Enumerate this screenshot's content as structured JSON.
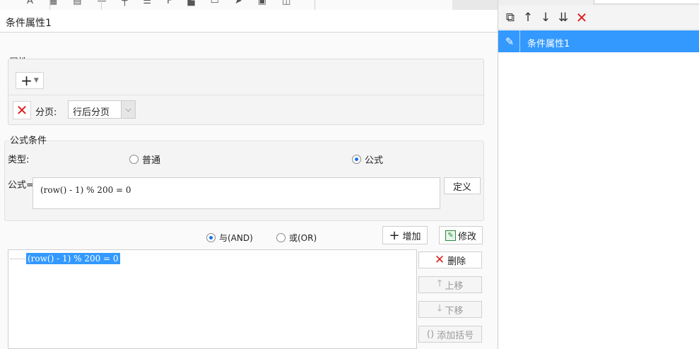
{
  "window": {
    "title": "条件属性1"
  },
  "attributes": {
    "section_label": "属性:",
    "add_label": "+",
    "page_break": {
      "label": "分页:",
      "value": "行后分页"
    }
  },
  "formula_condition": {
    "section_label": "公式条件",
    "type_label": "类型:",
    "type_options": [
      {
        "label": "普通",
        "selected": false
      },
      {
        "label": "公式",
        "selected": true
      }
    ],
    "formula_label": "公式=",
    "formula_value": "(row() - 1) % 200 = 0",
    "define_label": "定义"
  },
  "logic": {
    "and_label": "与(AND)",
    "and_selected": true,
    "or_label": "或(OR)",
    "or_selected": false,
    "add_label": "增加",
    "modify_label": "修改"
  },
  "condition_list": {
    "items": [
      {
        "text": "(row() - 1) % 200 = 0",
        "selected": true
      }
    ]
  },
  "list_actions": {
    "delete_label": "删除",
    "move_up_label": "上移",
    "move_down_label": "下移",
    "add_bracket_label": "添加括号"
  },
  "right_panel": {
    "items": [
      {
        "label": "条件属性1",
        "selected": true
      }
    ]
  },
  "colors": {
    "accent": "#3399ff",
    "danger": "#e02020"
  }
}
